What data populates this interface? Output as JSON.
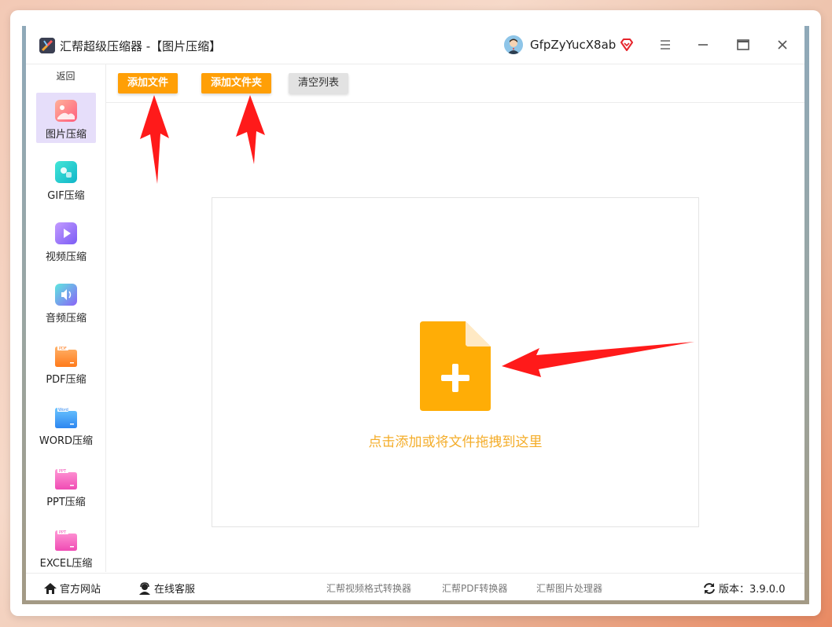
{
  "window": {
    "title": "汇帮超级压缩器 -【图片压缩】",
    "username": "GfpZyYucX8ab"
  },
  "sidebar": {
    "back_label": "返回",
    "items": [
      {
        "label": "图片压缩",
        "icon": "image-icon",
        "active": true
      },
      {
        "label": "GIF压缩",
        "icon": "gif-icon",
        "active": false
      },
      {
        "label": "视频压缩",
        "icon": "video-play-icon",
        "active": false
      },
      {
        "label": "音频压缩",
        "icon": "audio-speaker-icon",
        "active": false
      },
      {
        "label": "PDF压缩",
        "icon": "pdf-folder-icon",
        "active": false
      },
      {
        "label": "WORD压缩",
        "icon": "word-folder-icon",
        "active": false
      },
      {
        "label": "PPT压缩",
        "icon": "ppt-folder-icon",
        "active": false
      },
      {
        "label": "EXCEL压缩",
        "icon": "excel-folder-icon",
        "active": false
      }
    ],
    "folder_tags": {
      "pdf": "PDF",
      "word": "Word",
      "ppt": "PPT",
      "excel": "PPT"
    }
  },
  "toolbar": {
    "add_file": "添加文件",
    "add_folder": "添加文件夹",
    "clear_list": "清空列表"
  },
  "dropzone": {
    "hint": "点击添加或将文件拖拽到这里"
  },
  "footer": {
    "official_site": "官方网站",
    "online_service": "在线客服",
    "links": [
      "汇帮视频格式转换器",
      "汇帮PDF转换器",
      "汇帮图片处理器"
    ],
    "version": "版本：3.9.0.0"
  },
  "colors": {
    "accent_orange": "#ff9f06",
    "hint_text": "#f4ad2a",
    "active_nav_bg": "#e6defa",
    "annotation_red": "#ff1a1a"
  }
}
